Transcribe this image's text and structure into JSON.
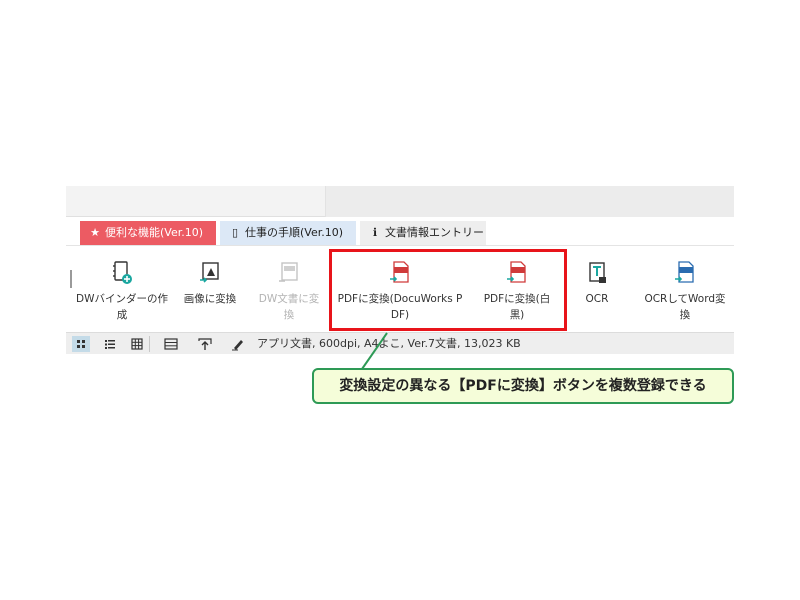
{
  "tabs": [
    {
      "label": "便利な機能(Ver.10)",
      "icon": "star-icon"
    },
    {
      "label": "仕事の手順(Ver.10)",
      "icon": "building-icon"
    },
    {
      "label": "文書情報エントリー",
      "icon": "info-icon"
    }
  ],
  "ribbon": [
    {
      "label": "DWバインダーの作\n成",
      "icon": "binder-add-icon",
      "enabled": true
    },
    {
      "label": "画像に変換",
      "icon": "image-convert-icon",
      "enabled": true
    },
    {
      "label": "DW文書に変\n換",
      "icon": "dw-convert-icon",
      "enabled": false
    },
    {
      "label": "PDFに変換(DocuWorks P\nDF)",
      "icon": "pdf-convert-icon",
      "enabled": true
    },
    {
      "label": "PDFに変換(白\n黒)",
      "icon": "pdf-convert-icon",
      "enabled": true
    },
    {
      "label": "OCR",
      "icon": "ocr-icon",
      "enabled": true
    },
    {
      "label": "OCRしてWord変\n換",
      "icon": "docx-convert-icon",
      "enabled": true
    }
  ],
  "status": {
    "text": "アプリ文書, 600dpi, A4よこ, Ver.7文書, 13,023 KB",
    "icons": [
      "thumbnail-view-icon",
      "list-view-icon",
      "grid-view-icon",
      "single-view-icon",
      "upload-icon",
      "pen-icon"
    ]
  },
  "callout": {
    "text": "変換設定の異なる【PDFに変換】ボタンを複数登録できる"
  },
  "colors": {
    "tab_active": "#ec5b63",
    "highlight": "#e8141a",
    "callout_border": "#2e9a56",
    "callout_bg": "#f5fdd9",
    "icon_teal": "#1aa7a0"
  }
}
